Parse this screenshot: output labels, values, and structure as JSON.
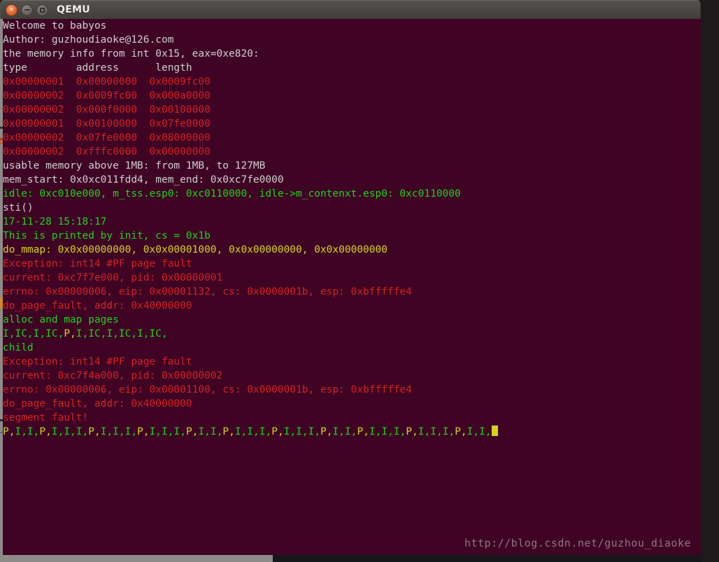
{
  "window": {
    "title": "QEMU",
    "controls": [
      {
        "name": "close",
        "glyph": "×"
      },
      {
        "name": "minimize",
        "glyph": ""
      },
      {
        "name": "maximize",
        "glyph": ""
      }
    ]
  },
  "colors": {
    "console_bg": "#3f0424",
    "titlebar": "#4b4745",
    "white": "#cfcfcf",
    "red": "#d42121",
    "green": "#1dd41d",
    "yellow": "#d4d420",
    "close_button": "#e8703a",
    "watermark": "#9b8a93"
  },
  "console": {
    "lines": [
      {
        "segments": [
          {
            "text": "Welcome to babyos",
            "color": "white"
          }
        ]
      },
      {
        "segments": [
          {
            "text": "Author: guzhoudiaoke@126.com",
            "color": "white"
          }
        ]
      },
      {
        "segments": [
          {
            "text": "the memory info from int 0x15, eax=0xe820:",
            "color": "white"
          }
        ]
      },
      {
        "segments": [
          {
            "text": "type        address      length",
            "color": "white"
          }
        ]
      },
      {
        "segments": [
          {
            "text": "0x00000001  0x00000000  0x0009fc00",
            "color": "red"
          }
        ]
      },
      {
        "segments": [
          {
            "text": "0x00000002  0x0009fc00  0x000a0000",
            "color": "red"
          }
        ]
      },
      {
        "segments": [
          {
            "text": "0x00000002  0x000f0000  0x00100000",
            "color": "red"
          }
        ]
      },
      {
        "segments": [
          {
            "text": "0x00000001  0x00100000  0x07fe0000",
            "color": "red"
          }
        ]
      },
      {
        "segments": [
          {
            "text": "0x00000002  0x07fe0000  0x08000000",
            "color": "red"
          }
        ]
      },
      {
        "segments": [
          {
            "text": "0x00000002  0xfffc0000  0x00000000",
            "color": "red"
          }
        ]
      },
      {
        "segments": [
          {
            "text": "usable memory above 1MB: from 1MB, to 127MB",
            "color": "white"
          }
        ]
      },
      {
        "segments": [
          {
            "text": "mem_start: 0x0xc011fdd4, mem_end: 0x0xc7fe0000",
            "color": "white"
          }
        ]
      },
      {
        "segments": [
          {
            "text": "idle: 0xc010e000, m_tss.esp0: 0xc0110000, idle->m_contenxt.esp0: 0xc0110000",
            "color": "green"
          }
        ]
      },
      {
        "segments": [
          {
            "text": "sti()",
            "color": "white"
          }
        ]
      },
      {
        "segments": [
          {
            "text": "17-11-28 15:18:17",
            "color": "green"
          }
        ]
      },
      {
        "segments": [
          {
            "text": "This is printed by init, cs = 0x1b",
            "color": "green"
          }
        ]
      },
      {
        "segments": [
          {
            "text": "do_mmap: 0x0x00000000, 0x0x00001000, 0x0x00000000, 0x0x00000000",
            "color": "yellow"
          }
        ]
      },
      {
        "segments": [
          {
            "text": "Exception: int14 #PF page fault",
            "color": "red"
          }
        ]
      },
      {
        "segments": [
          {
            "text": "current: 0xc7f7e000, pid: 0x00000001",
            "color": "red"
          }
        ]
      },
      {
        "segments": [
          {
            "text": "errno: 0x00000006, eip: 0x00001132, cs: 0x0000001b, esp: 0xbfffffe4",
            "color": "red"
          }
        ]
      },
      {
        "segments": [
          {
            "text": "do_page_fault, addr: 0x40000000",
            "color": "red"
          }
        ]
      },
      {
        "segments": [
          {
            "text": "alloc and map pages",
            "color": "green"
          }
        ]
      },
      {
        "segments": [
          {
            "text": "I,IC,I,IC,",
            "color": "green"
          },
          {
            "text": "P,",
            "color": "yellow"
          },
          {
            "text": "I,IC,I,IC,I,IC,",
            "color": "green"
          }
        ]
      },
      {
        "segments": [
          {
            "text": "child",
            "color": "green"
          }
        ]
      },
      {
        "segments": [
          {
            "text": "Exception: int14 #PF page fault",
            "color": "red"
          }
        ]
      },
      {
        "segments": [
          {
            "text": "current: 0xc7f4a000, pid: 0x00000002",
            "color": "red"
          }
        ]
      },
      {
        "segments": [
          {
            "text": "errno: 0x00000006, eip: 0x00001100, cs: 0x0000001b, esp: 0xbfffffe4",
            "color": "red"
          }
        ]
      },
      {
        "segments": [
          {
            "text": "do_page_fault, addr: 0x40000000",
            "color": "red"
          }
        ]
      },
      {
        "segments": [
          {
            "text": "segment fault!",
            "color": "red"
          }
        ]
      },
      {
        "segments": [
          {
            "text": "P,",
            "color": "yellow"
          },
          {
            "text": "I,I,",
            "color": "green"
          },
          {
            "text": "P,",
            "color": "yellow"
          },
          {
            "text": "I,I,I,",
            "color": "green"
          },
          {
            "text": "P,",
            "color": "yellow"
          },
          {
            "text": "I,I,I,",
            "color": "green"
          },
          {
            "text": "P,",
            "color": "yellow"
          },
          {
            "text": "I,I,I,",
            "color": "green"
          },
          {
            "text": "P,",
            "color": "yellow"
          },
          {
            "text": "I,I,",
            "color": "green"
          },
          {
            "text": "P,",
            "color": "yellow"
          },
          {
            "text": "I,I,I,",
            "color": "green"
          },
          {
            "text": "P,",
            "color": "yellow"
          },
          {
            "text": "I,I,I,",
            "color": "green"
          },
          {
            "text": "P,",
            "color": "yellow"
          },
          {
            "text": "I,I,",
            "color": "green"
          },
          {
            "text": "P,",
            "color": "yellow"
          },
          {
            "text": "I,I,I,",
            "color": "green"
          },
          {
            "text": "P,",
            "color": "yellow"
          },
          {
            "text": "I,I,I,",
            "color": "green"
          },
          {
            "text": "P,",
            "color": "yellow"
          },
          {
            "text": "I,I,",
            "color": "green"
          }
        ],
        "cursor": true
      }
    ]
  },
  "watermark": {
    "text": "http://blog.csdn.net/guzhou_diaoke"
  }
}
